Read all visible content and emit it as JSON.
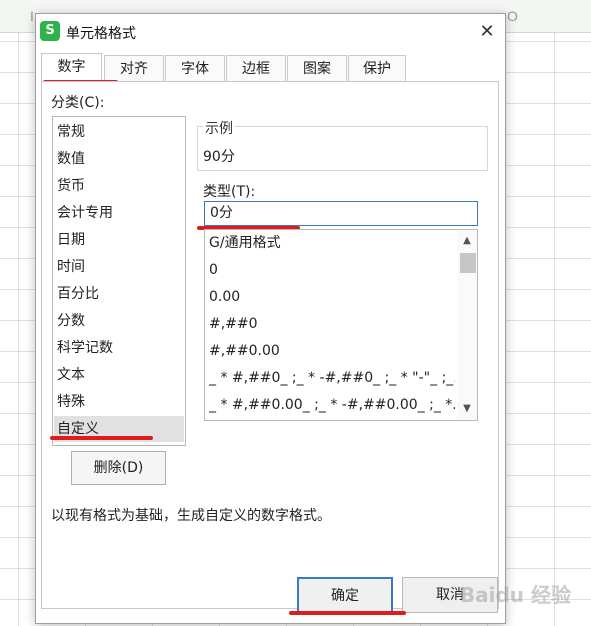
{
  "background": {
    "column_letters": [
      "I",
      "O"
    ]
  },
  "dialog": {
    "title": "单元格格式",
    "app_icon_letter": "S",
    "close_glyph": "✕",
    "tabs": [
      {
        "label": "数字",
        "active": true
      },
      {
        "label": "对齐",
        "active": false
      },
      {
        "label": "字体",
        "active": false
      },
      {
        "label": "边框",
        "active": false
      },
      {
        "label": "图案",
        "active": false
      },
      {
        "label": "保护",
        "active": false
      }
    ],
    "category_label": "分类(C):",
    "categories": [
      "常规",
      "数值",
      "货币",
      "会计专用",
      "日期",
      "时间",
      "百分比",
      "分数",
      "科学记数",
      "文本",
      "特殊",
      "自定义"
    ],
    "selected_category": "自定义",
    "delete_button": "删除(D)",
    "sample_legend": "示例",
    "sample_value": "90分",
    "type_label": "类型(T):",
    "type_value": "0分",
    "format_list": [
      "G/通用格式",
      "0",
      "0.00",
      "#,##0",
      "#,##0.00",
      "_ * #,##0_ ;_ * -#,##0_ ;_ * \"-\"_ ;_...",
      "_ * #,##0.00_ ;_ * -#,##0.00_ ;_ *..."
    ],
    "description": "以现有格式为基础，生成自定义的数字格式。",
    "ok_button": "确定",
    "cancel_button": "取消",
    "accent_color": "#3a78c9",
    "highlight_color": "#e01b1b",
    "icon_color": "#2db34a"
  },
  "watermark": "Baidu 经验"
}
